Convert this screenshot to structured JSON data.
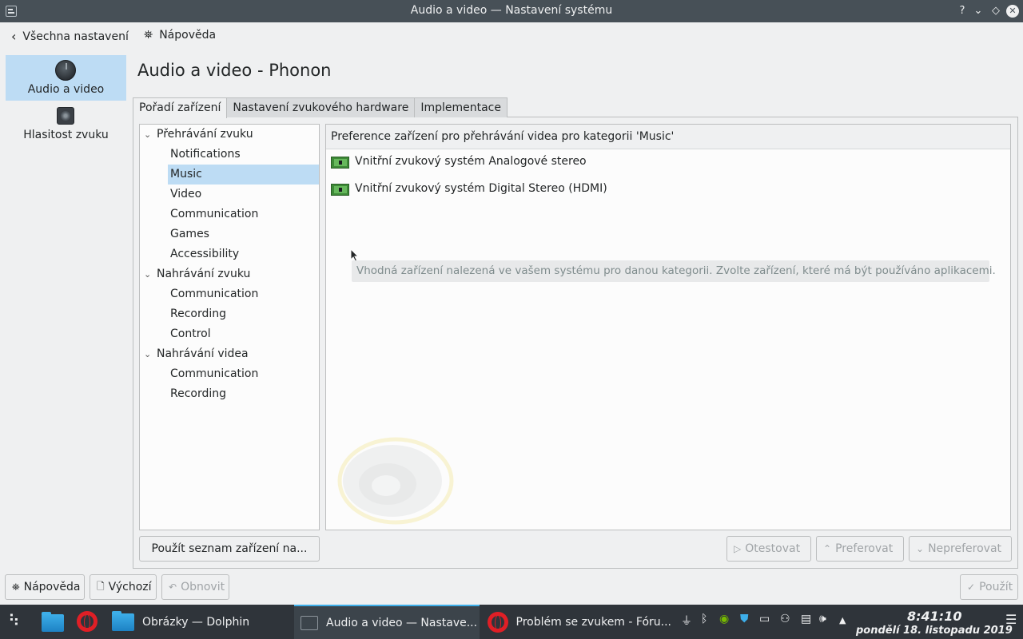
{
  "window": {
    "title": "Audio a video — Nastavení systému",
    "controls": [
      "?",
      "⌄",
      "◇",
      "✕"
    ]
  },
  "toolbar": {
    "back_label": "Všechna nastavení",
    "help_label": "Nápověda"
  },
  "sidebar": {
    "items": [
      {
        "label": "Audio a video",
        "icon": "knob-icon",
        "active": true
      },
      {
        "label": "Hlasitost zvuku",
        "icon": "speaker-icon",
        "active": false
      }
    ]
  },
  "main": {
    "title": "Audio a video - Phonon",
    "tabs": [
      {
        "label": "Pořadí zařízení",
        "active": true
      },
      {
        "label": "Nastavení zvukového hardware",
        "active": false
      },
      {
        "label": "Implementace",
        "active": false
      }
    ],
    "tree": [
      {
        "label": "Přehrávání zvuku",
        "level": 0,
        "expanded": true
      },
      {
        "label": "Notifications",
        "level": 1
      },
      {
        "label": "Music",
        "level": 1,
        "selected": true
      },
      {
        "label": "Video",
        "level": 1
      },
      {
        "label": "Communication",
        "level": 1
      },
      {
        "label": "Games",
        "level": 1
      },
      {
        "label": "Accessibility",
        "level": 1
      },
      {
        "label": "Nahrávání zvuku",
        "level": 0,
        "expanded": true
      },
      {
        "label": "Communication",
        "level": 1
      },
      {
        "label": "Recording",
        "level": 1
      },
      {
        "label": "Control",
        "level": 1
      },
      {
        "label": "Nahrávání videa",
        "level": 0,
        "expanded": true
      },
      {
        "label": "Communication",
        "level": 1
      },
      {
        "label": "Recording",
        "level": 1
      }
    ],
    "device_header": "Preference zařízení pro přehrávání videa pro kategorii 'Music'",
    "devices": [
      "Vnitřní zvukový systém Analogové stereo",
      "Vnitřní zvukový systém Digital Stereo (HDMI)"
    ],
    "tooltip": "Vhodná zařízení nalezená ve vašem systému pro danou kategorii. Zvolte zařízení, které má být používáno aplikacemi.",
    "apply_list_label": "Použít seznam zařízení na...",
    "test_label": "Otestovat",
    "prefer_label": "Preferovat",
    "defer_label": "Nepreferovat"
  },
  "footer": {
    "help_label": "Nápověda",
    "defaults_label": "Výchozí",
    "reset_label": "Obnovit",
    "apply_label": "Použít"
  },
  "taskbar": {
    "tasks": [
      {
        "label": "Obrázky — Dolphin"
      },
      {
        "label": "Audio a video  — Nastave..."
      },
      {
        "label": "Problém se zvukem - Fóru..."
      }
    ],
    "clock_time": "8:41:10",
    "clock_date": "pondělí 18. listopadu 2019"
  }
}
